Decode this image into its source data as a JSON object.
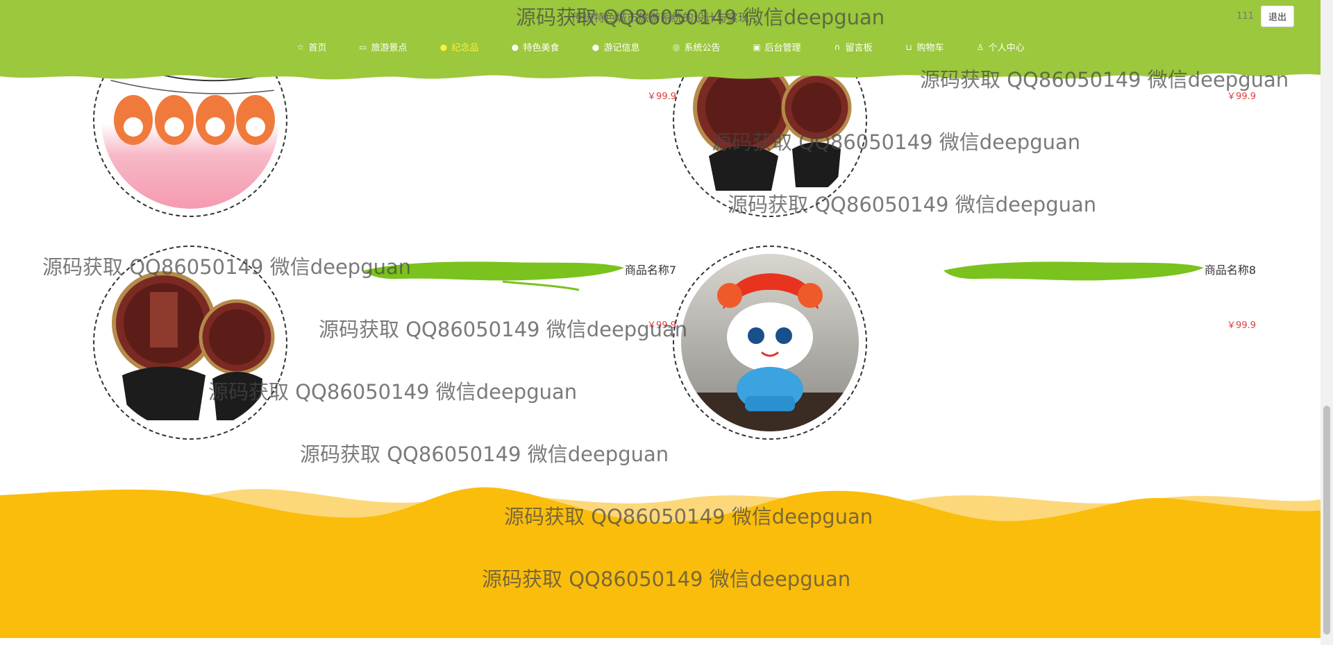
{
  "header": {
    "title": "传统特色城市旅游系统的设计与实现",
    "user_name": "111",
    "logout_label": "退出",
    "bg_color": "#9bc83c"
  },
  "nav": [
    {
      "label": "首页",
      "icon": "home-icon"
    },
    {
      "label": "旅游景点",
      "icon": "bag-icon"
    },
    {
      "label": "纪念品",
      "icon": "gift-icon",
      "active": true
    },
    {
      "label": "特色美食",
      "icon": "food-icon"
    },
    {
      "label": "游记信息",
      "icon": "info-icon"
    },
    {
      "label": "系统公告",
      "icon": "notice-icon"
    },
    {
      "label": "后台管理",
      "icon": "admin-icon"
    },
    {
      "label": "留言板",
      "icon": "headset-icon"
    },
    {
      "label": "购物车",
      "icon": "cart-icon"
    },
    {
      "label": "个人中心",
      "icon": "user-icon"
    }
  ],
  "products": [
    {
      "name": "",
      "price": "￥99.9",
      "image": "lucky-cat-ornaments"
    },
    {
      "name": "",
      "price": "￥99.9",
      "image": "lacquer-carving-plaques"
    },
    {
      "name": "商品名称7",
      "price": "￥99.9",
      "image": "lacquer-carving-plaques"
    },
    {
      "name": "商品名称8",
      "price": "￥99.9",
      "image": "mascot-doll"
    }
  ],
  "footer": {
    "color": "#fbbd0c"
  },
  "watermark": "源码获取 QQ86050149 微信deepguan"
}
